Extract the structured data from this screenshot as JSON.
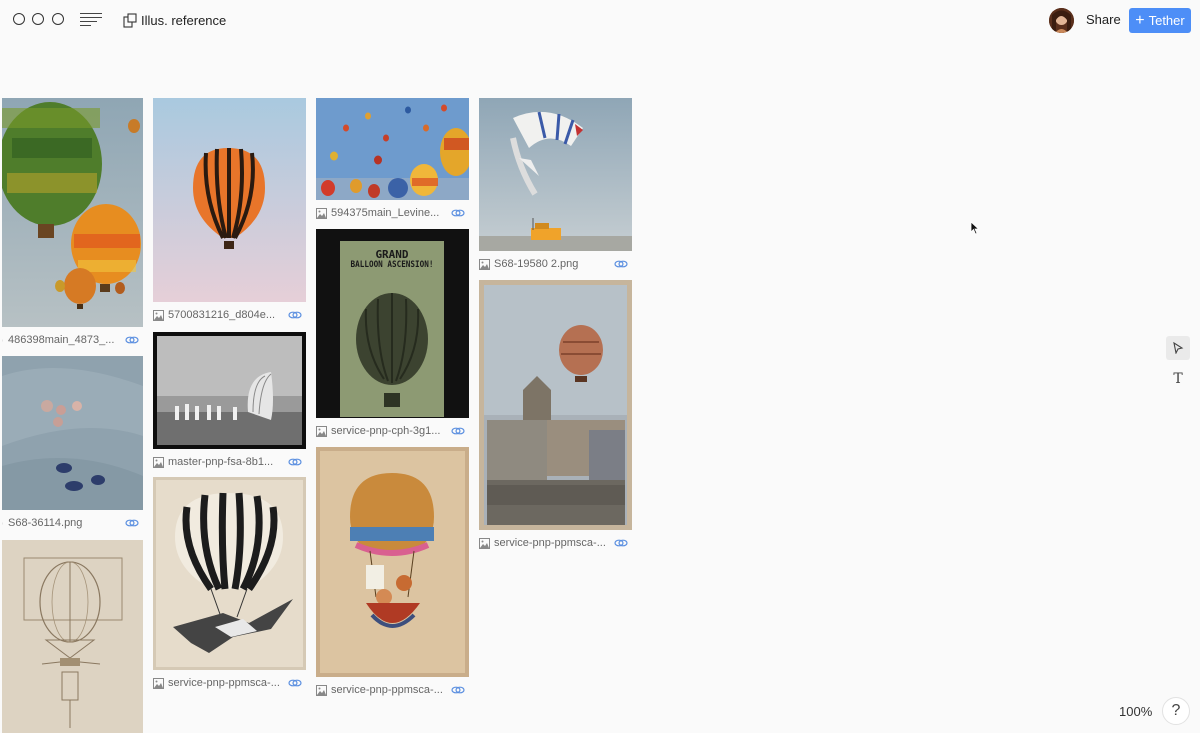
{
  "header": {
    "title": "Illus. reference",
    "share_label": "Share",
    "tether_label": "Tether"
  },
  "gallery": {
    "items": [
      {
        "caption": "486398main_4873_..."
      },
      {
        "caption": "S68-36114.png"
      },
      {
        "caption": "5700831216_d804e..."
      },
      {
        "caption": "master-pnp-fsa-8b1..."
      },
      {
        "caption": "service-pnp-ppmsca-..."
      },
      {
        "caption": "594375main_Levine..."
      },
      {
        "caption": "service-pnp-cph-3g1..."
      },
      {
        "caption": "service-pnp-ppmsca-..."
      },
      {
        "caption": "S68-19580 2.png"
      },
      {
        "caption": "service-pnp-ppmsca-..."
      }
    ]
  },
  "poster": {
    "line1": "GRAND",
    "line2": "BALLOON ASCENSION!"
  },
  "footer": {
    "zoom": "100%",
    "help": "?"
  },
  "icons": {
    "window": [
      "circle-icon",
      "circle-icon",
      "circle-icon"
    ],
    "menu": "menu-icon",
    "board": "board-icon",
    "select": "pointer-icon",
    "text": "text-tool-icon",
    "image": "image-icon",
    "link": "link-icon"
  },
  "colors": {
    "accent": "#4d8ef7",
    "link_icon": "#5b8fe0",
    "background": "#fafafa"
  }
}
